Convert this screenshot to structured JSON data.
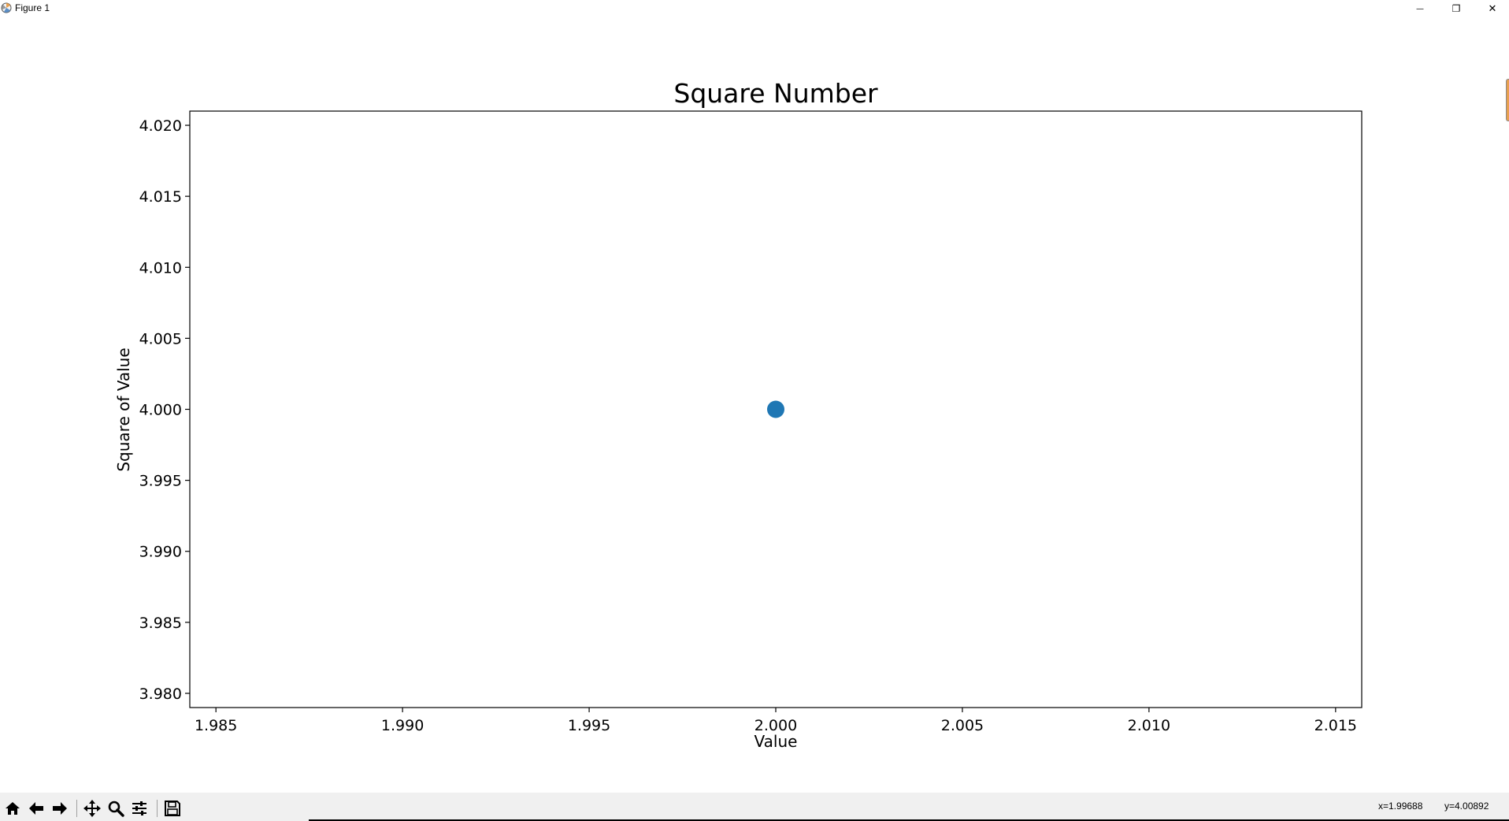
{
  "window": {
    "title": "Figure 1",
    "controls": {
      "minimize": "—",
      "maximize": "❐",
      "close": "✕"
    }
  },
  "toolbar": {
    "buttons": [
      {
        "name": "home-icon",
        "label": "Home"
      },
      {
        "name": "back-icon",
        "label": "Back"
      },
      {
        "name": "forward-icon",
        "label": "Forward"
      },
      {
        "name": "pan-icon",
        "label": "Pan"
      },
      {
        "name": "zoom-icon",
        "label": "Zoom"
      },
      {
        "name": "configure-subplots-icon",
        "label": "Configure subplots"
      },
      {
        "name": "save-icon",
        "label": "Save"
      }
    ],
    "coord_x": "x=1.99688",
    "coord_y": "y=4.00892"
  },
  "colors": {
    "marker": "#1f77b4",
    "toolbar_bg": "#f0f0f0"
  },
  "chart_data": {
    "type": "scatter",
    "title": "Square Number",
    "xlabel": "Value",
    "ylabel": "Square of Value",
    "x": [
      2
    ],
    "y": [
      4
    ],
    "xlim": [
      1.9843,
      2.0157
    ],
    "ylim": [
      3.979,
      4.021
    ],
    "xticks": [
      "1.985",
      "1.990",
      "1.995",
      "2.000",
      "2.005",
      "2.010",
      "2.015"
    ],
    "xtick_values": [
      1.985,
      1.99,
      1.995,
      2.0,
      2.005,
      2.01,
      2.015
    ],
    "yticks": [
      "3.980",
      "3.985",
      "3.990",
      "3.995",
      "4.000",
      "4.005",
      "4.010",
      "4.015",
      "4.020"
    ],
    "ytick_values": [
      3.98,
      3.985,
      3.99,
      3.995,
      4.0,
      4.005,
      4.01,
      4.015,
      4.02
    ],
    "grid": false,
    "legend": "none"
  }
}
